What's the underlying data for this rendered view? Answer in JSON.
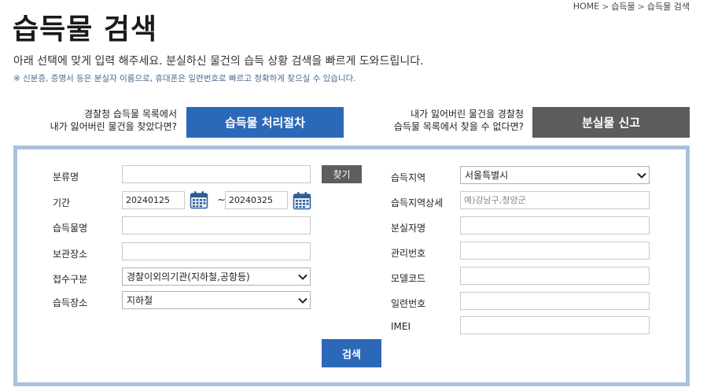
{
  "breadcrumb": {
    "home": "HOME",
    "level1": "습득물",
    "level2": "습득물 검색",
    "separator": ">"
  },
  "page": {
    "title": "습득물 검색",
    "description": "아래 선택에 맞게 입력 해주세요. 분실하신 물건의 습득 상황 검색을 빠르게 도와드립니다.",
    "note": "※ 신분증, 증명서 등은 분실자 이름으로, 휴대폰은 일련번호로 빠르고 정확하게 찾으실 수 있습니다."
  },
  "promo": {
    "left_line1": "경찰청 습득물 목록에서",
    "left_line2": "내가 잃어버린 물건을 찾았다면?",
    "left_button": "습득물 처리절차",
    "right_line1": "내가 잃어버린 물건을 경찰청",
    "right_line2": "습득물 목록에서 찾을 수 없다면?",
    "right_button": "분실물 신고"
  },
  "form": {
    "category": {
      "label": "분류명",
      "value": "",
      "find_button": "찾기"
    },
    "period": {
      "label": "기간",
      "start": "20240125",
      "end": "20240325",
      "separator": "~"
    },
    "item_name": {
      "label": "습득물명",
      "value": ""
    },
    "storage": {
      "label": "보관장소",
      "value": ""
    },
    "reception": {
      "label": "접수구분",
      "selected": "경찰이외의기관(지하철,공항등)"
    },
    "place": {
      "label": "습득장소",
      "selected": "지하철"
    },
    "region": {
      "label": "습득지역",
      "selected": "서울특별시"
    },
    "region_detail": {
      "label": "습득지역상세",
      "placeholder": "예)강남구,청양군",
      "value": ""
    },
    "owner_name": {
      "label": "분실자명",
      "value": ""
    },
    "manage_no": {
      "label": "관리번호",
      "value": ""
    },
    "model_code": {
      "label": "모델코드",
      "value": ""
    },
    "serial_no": {
      "label": "일련번호",
      "value": ""
    },
    "imei": {
      "label": "IMEI",
      "value": ""
    },
    "search_button": "검색"
  },
  "colors": {
    "primary": "#2c68b8",
    "dark_button": "#5e5e5e",
    "report_button": "#5c5c5c",
    "border": "#a9c1dc",
    "note": "#4a6b93"
  },
  "icons": {
    "calendar": "calendar-icon",
    "dropdown": "chevron-down-icon"
  }
}
